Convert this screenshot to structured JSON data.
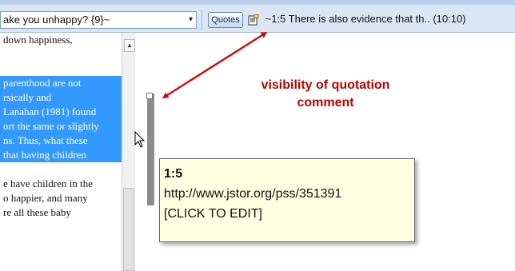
{
  "toolbar": {
    "code_combo_value": "ake you unhappy? {9}~",
    "combo_arrow": "▾",
    "quotes_label": "Quotes",
    "quote_text": "~1:5 There is also evidence that th.. (10:10)"
  },
  "document": {
    "lines": [
      {
        "text": "down happiness,",
        "selected": false
      },
      {
        "text": "",
        "selected": false
      },
      {
        "text": "",
        "selected": false
      },
      {
        "text": "parenthood are not",
        "selected": true
      },
      {
        "text": "rsically and",
        "selected": true
      },
      {
        "text": "Lanahan (1981) found",
        "selected": true
      },
      {
        "text": "ort the same or slightly",
        "selected": true
      },
      {
        "text": "ns. Thus, what these",
        "selected": true
      },
      {
        "text": "that having children",
        "selected": true
      },
      {
        "text": "",
        "selected": false
      },
      {
        "text": "e have children in the",
        "selected": false
      },
      {
        "text": "o happier, and many",
        "selected": false
      },
      {
        "text": "re all these baby",
        "selected": false
      }
    ]
  },
  "annotation": {
    "line1": "visibility of quotation",
    "line2": "comment",
    "color": "#c00000"
  },
  "tooltip": {
    "id": "1:5",
    "url": "http://www.jstor.org/pss/351391",
    "edit": "[CLICK TO EDIT]"
  }
}
